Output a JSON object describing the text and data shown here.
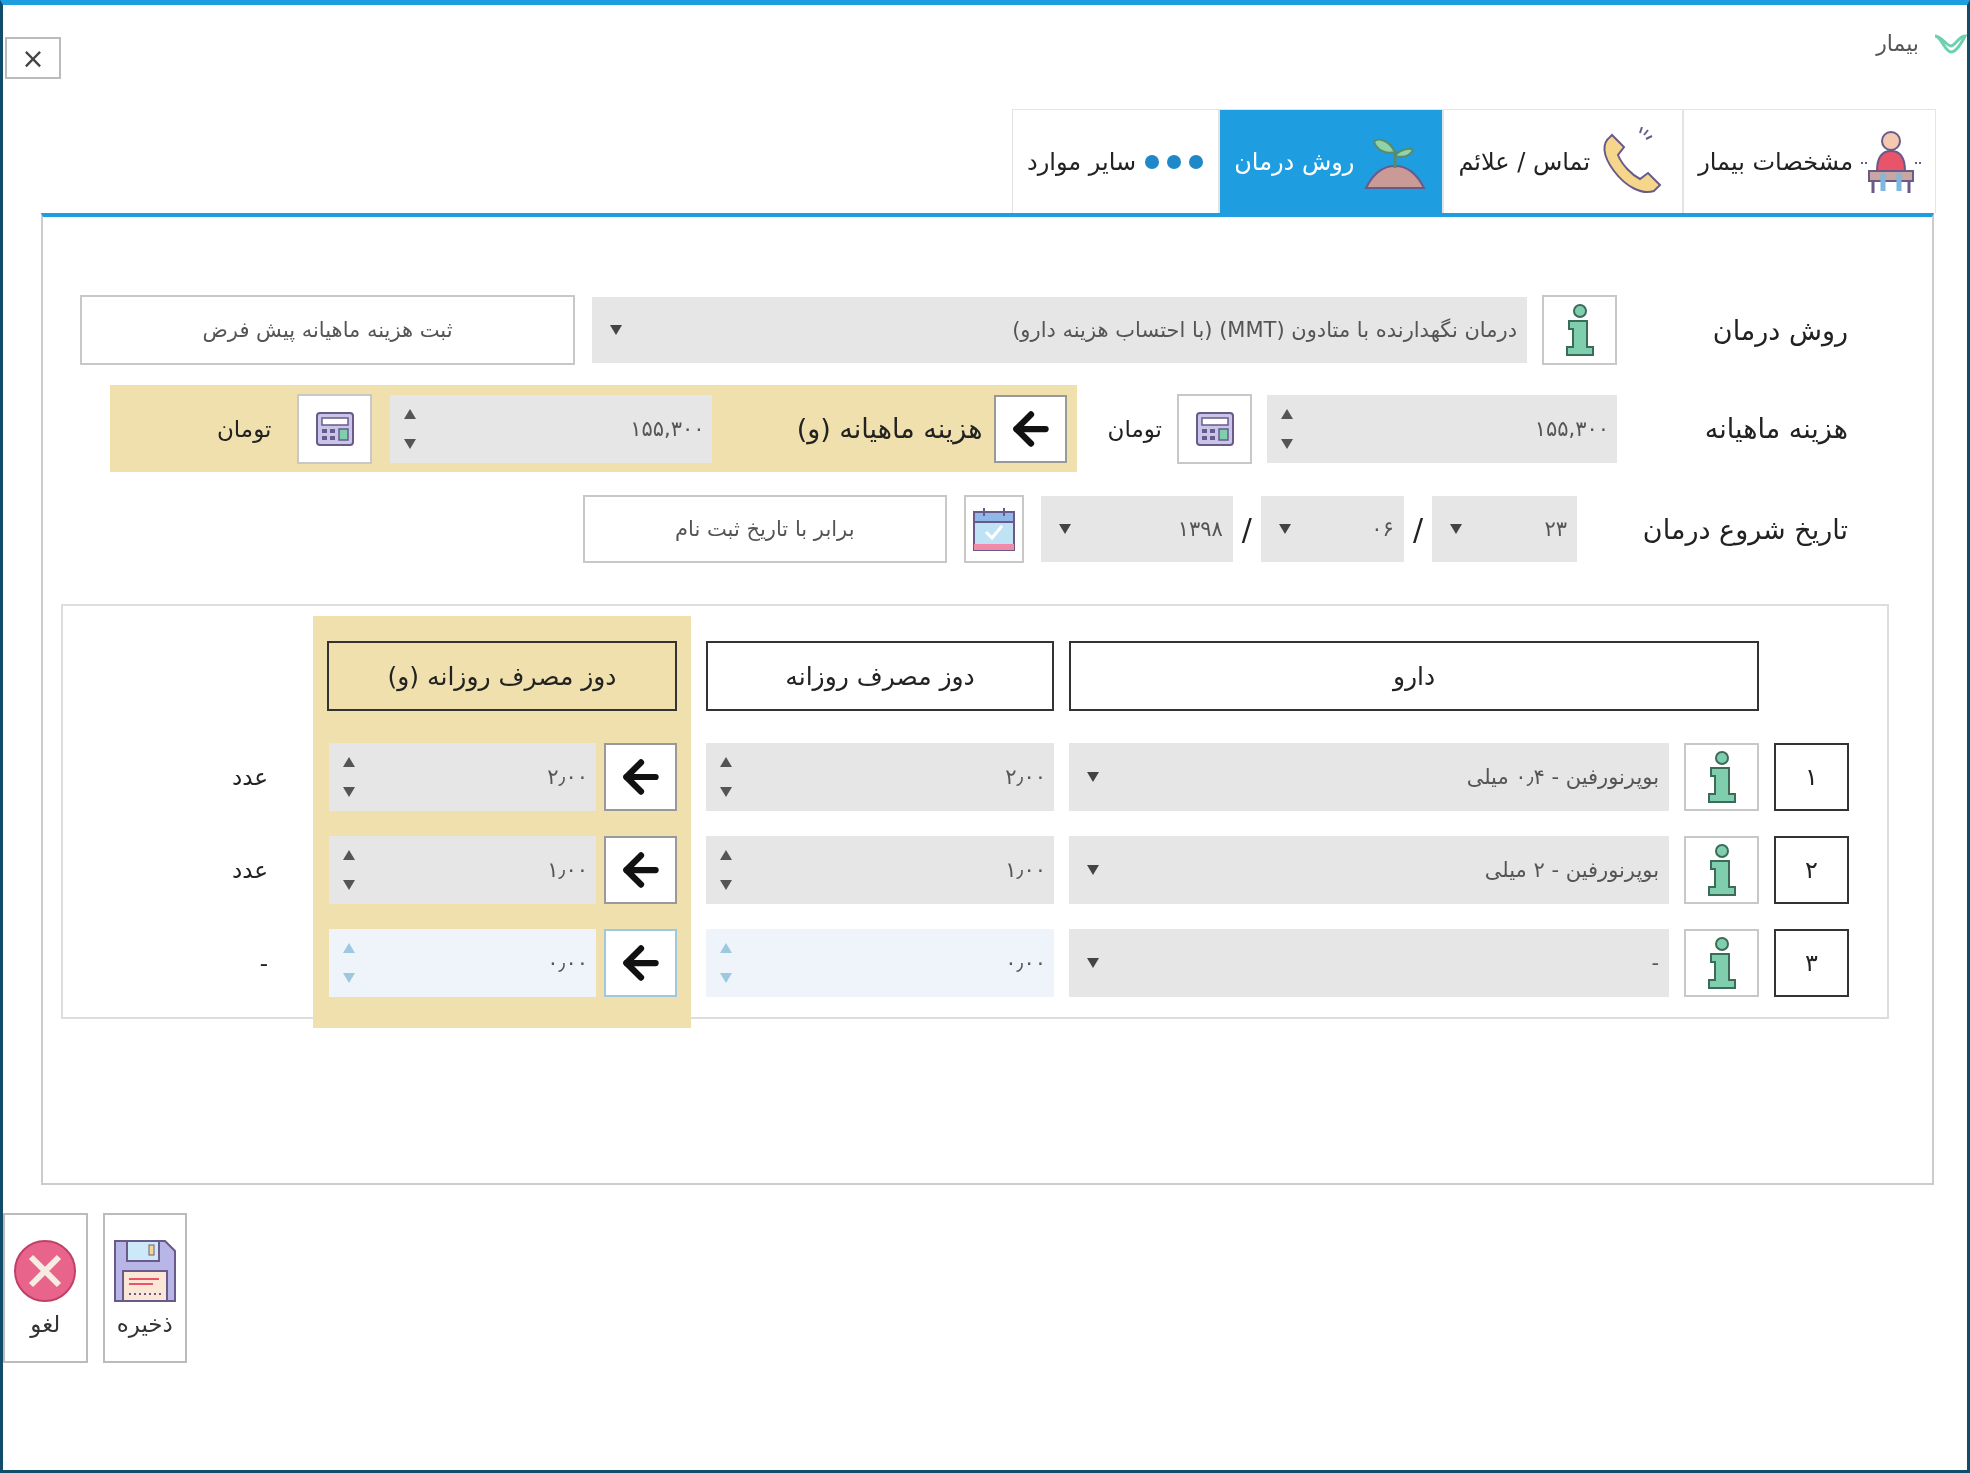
{
  "window": {
    "title": "بیمار",
    "close": "×"
  },
  "tabs": [
    {
      "label": "مشخصات بیمار",
      "kind": "patient",
      "selected": false
    },
    {
      "label": "تماس / علائم",
      "kind": "phone",
      "selected": false
    },
    {
      "label": "روش درمان",
      "kind": "plant",
      "selected": true
    },
    {
      "label": "سایر موارد",
      "kind": "dots",
      "selected": false
    }
  ],
  "form": {
    "treatment_method": {
      "label": "روش درمان",
      "value": "درمان نگهدارنده با متادون (MMT) (با احتساب هزینه دارو)"
    },
    "default_cost_button": "ثبت هزینه ماهیانه پیش فرض",
    "monthly_cost": {
      "label": "هزینه ماهیانه",
      "value": "۱۵۵,۳۰۰",
      "unit": "تومان"
    },
    "monthly_cost_v": {
      "label": "هزینه ماهیانه (و)",
      "value": "۱۵۵,۳۰۰",
      "unit": "تومان"
    },
    "start_date": {
      "label": "تاریخ شروع درمان",
      "day": "۲۳",
      "month": "۰۶",
      "year": "۱۳۹۸",
      "separators": [
        "/",
        "/"
      ]
    },
    "same_as_registration_button": "برابر با تاریخ ثبت نام"
  },
  "table": {
    "columns": [
      "دارو",
      "دوز مصرف روزانه",
      "دوز مصرف روزانه (و)"
    ],
    "rows": [
      {
        "number": "۱",
        "drug": "بوپرنورفین - ۰٫۴ میلی",
        "dose": "۲٫۰۰",
        "dose_v": "۲٫۰۰",
        "unit": "عدد",
        "disabled": false
      },
      {
        "number": "۲",
        "drug": "بوپرنورفین - ۲ میلی",
        "dose": "۱٫۰۰",
        "dose_v": "۱٫۰۰",
        "unit": "عدد",
        "disabled": false
      },
      {
        "number": "۳",
        "drug": "-",
        "dose": "۰٫۰۰",
        "dose_v": "۰٫۰۰",
        "unit": "-",
        "disabled": true
      }
    ]
  },
  "buttons": [
    {
      "kind": "save",
      "label": "ذخیره"
    },
    {
      "kind": "cancel",
      "label": "لغو"
    }
  ]
}
